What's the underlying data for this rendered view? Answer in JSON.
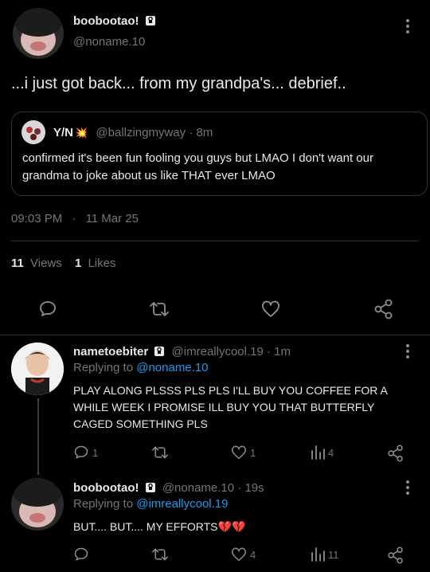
{
  "main_post": {
    "display_name": "boobootao!",
    "handle": "@noname.10",
    "text": "...i just got back... from my grandpa's... debrief..",
    "quote": {
      "display_name": "Y/N",
      "emoji": "💥",
      "handle": "@ballzingmyway",
      "time": "· 8m",
      "text": "confirmed it's been fun fooling you guys but LMAO I don't want our grandma to joke about us like THAT ever LMAO"
    },
    "timestamp": "09:03 PM",
    "date_sep": "·",
    "date": "11 Mar 25",
    "views_count": "11",
    "views_label": "Views",
    "likes_count": "1",
    "likes_label": "Likes"
  },
  "reply1": {
    "display_name": "nametoebiter",
    "handle": "@imreallycool.19",
    "time": "· 1m",
    "replying_prefix": "Replying to",
    "replying_handle": "@noname.10",
    "text": "PLAY ALONG PLSSS PLS PLS I'LL BUY YOU COFFEE FOR A WHILE WEEK I PROMISE ILL BUY YOU THAT BUTTERFLY CAGED SOMETHING PLS",
    "reply_count": "1",
    "like_count": "1",
    "view_count": "4"
  },
  "reply2": {
    "display_name": "boobootao!",
    "handle": "@noname.10",
    "time": "· 19s",
    "replying_prefix": "Replying to",
    "replying_handle": "@imreallycool.19",
    "text": "BUT.... BUT.... MY EFFORTS💔💔",
    "like_count": "4",
    "view_count": "11"
  },
  "colors": {
    "background": "#000000",
    "text": "#e7e9ea",
    "muted": "#71767b",
    "link": "#1d9bf0",
    "border": "#2f3336"
  }
}
